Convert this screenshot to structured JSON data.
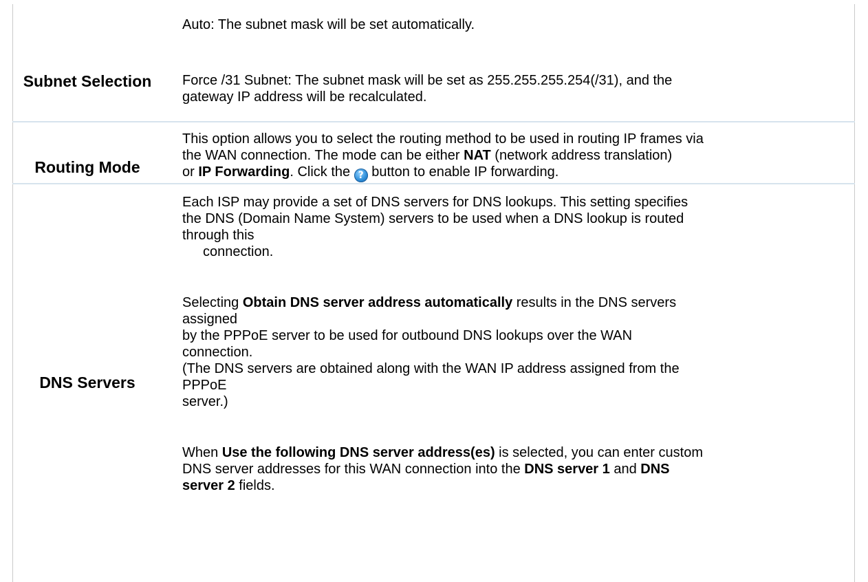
{
  "rows": [
    {
      "term": "Subnet Selection",
      "lines": [
        "Auto: The subnet mask will be set automatically.",
        "Force /31 Subnet: The subnet mask will be set as 255.255.255.254(/31), and the",
        "gateway IP address will be recalculated."
      ]
    },
    {
      "term": "Routing Mode",
      "line1": "This option allows you to select the routing method to be used in routing IP frames via",
      "line2_a": "the WAN connection. The mode can be either ",
      "line2_b": "NAT",
      "line2_c": " (network address translation)",
      "line3_a": "or ",
      "line3_b": "IP Forwarding",
      "line3_c": ". Click the ",
      "help_icon": "help-question-icon",
      "line3_d": " button to enable IP forwarding."
    },
    {
      "term": "DNS Servers",
      "p1": [
        "Each ISP may provide a set of DNS servers for DNS lookups. This setting specifies",
        "the DNS (Domain Name System) servers to be used when a DNS lookup is routed",
        "through this",
        "connection."
      ],
      "p2_a": "Selecting ",
      "p2_b": "Obtain DNS server address automatically",
      "p2_c": " results in the DNS servers",
      "p2_lines": [
        "assigned",
        "by the PPPoE server to be used for outbound DNS lookups over the WAN",
        "connection.",
        "(The DNS servers are obtained along with the WAN IP address assigned from the",
        "PPPoE",
        "server.)"
      ],
      "p3_a": "When ",
      "p3_b": "Use the following DNS server address(es)",
      "p3_c": " is selected, you can enter custom",
      "p3_d": "DNS server addresses for this WAN connection into the ",
      "p3_e": "DNS server 1",
      "p3_f": " and ",
      "p3_g": "DNS",
      "p3_h": "server 2",
      "p3_i": " fields."
    }
  ]
}
